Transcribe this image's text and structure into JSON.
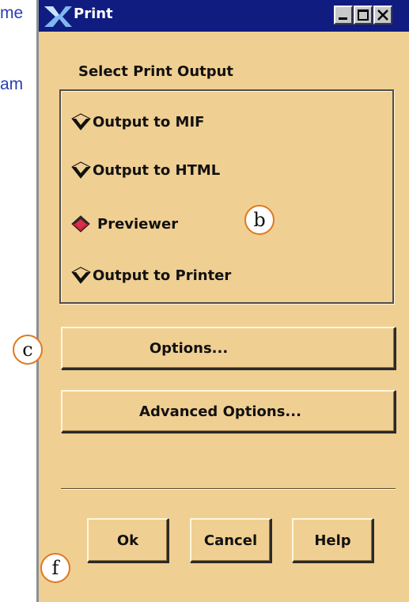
{
  "background": {
    "line1": "me",
    "line2": "am"
  },
  "window": {
    "title": "Print",
    "app_icon": "x-logo-icon"
  },
  "controls": {
    "minimize": "minimize-icon",
    "maximize": "maximize-icon",
    "close": "close-icon"
  },
  "group": {
    "label": "Select Print Output",
    "options": [
      {
        "label": "Output to MIF",
        "selected": false
      },
      {
        "label": "Output to HTML",
        "selected": false
      },
      {
        "label": "Previewer",
        "selected": true
      },
      {
        "label": "Output to Printer",
        "selected": false
      }
    ]
  },
  "buttons": {
    "options": "Options...",
    "advanced": "Advanced Options...",
    "ok": "Ok",
    "cancel": "Cancel",
    "help": "Help"
  },
  "callouts": {
    "b": "b",
    "c": "c",
    "f": "f"
  },
  "colors": {
    "titlebar": "#101c80",
    "window_bg": "#f0cf92",
    "selected_radio": "#c0243c",
    "background_text": "#2a3fb0",
    "callout_border": "#e0781e"
  }
}
